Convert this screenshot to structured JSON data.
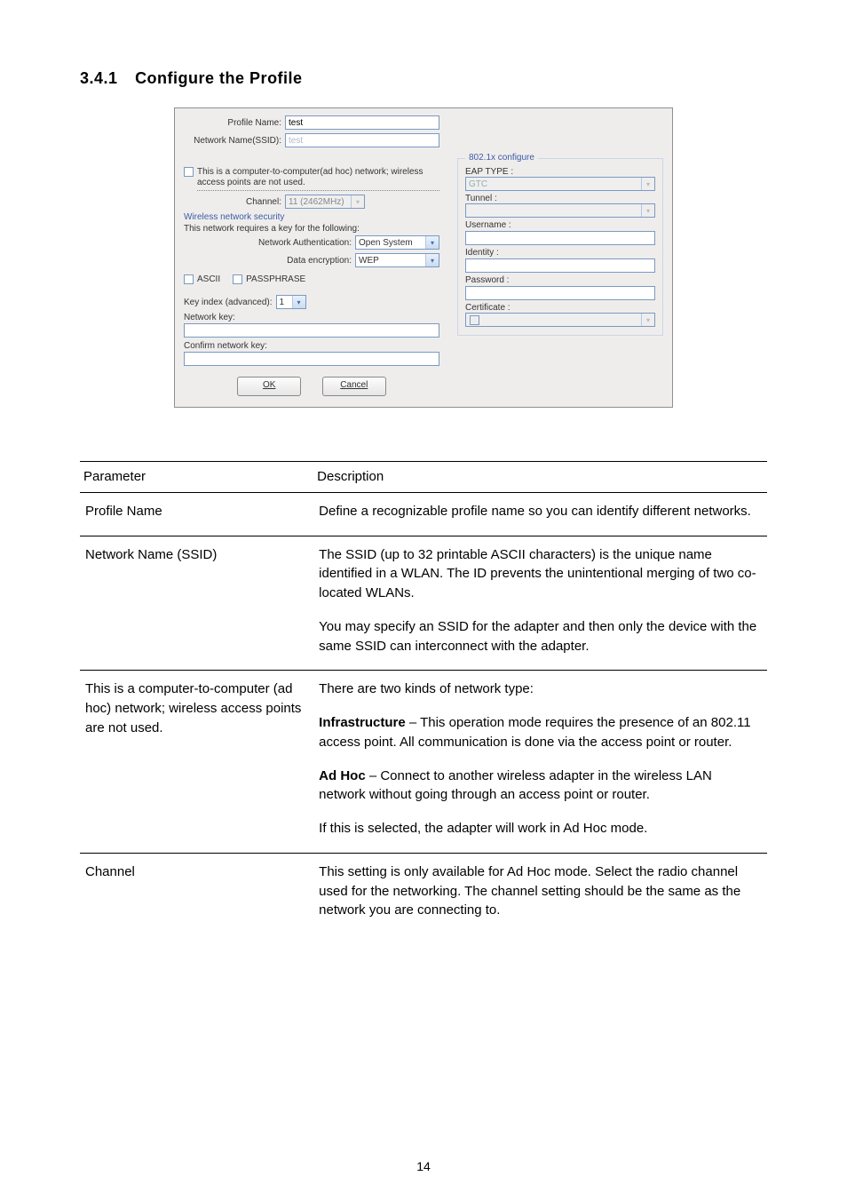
{
  "section": {
    "number": "3.4.1",
    "title": "Configure the Profile"
  },
  "dialog": {
    "profile_name_label": "Profile Name:",
    "profile_name_value": "test",
    "ssid_label": "Network Name(SSID):",
    "ssid_value": "test",
    "adhoc_label": "This is a computer-to-computer(ad hoc) network; wireless access points are not used.",
    "channel_label": "Channel:",
    "channel_value": "11 (2462MHz)",
    "security_heading": "Wireless network security",
    "security_subtext": "This network requires a key for the following:",
    "net_auth_label": "Network Authentication:",
    "net_auth_value": "Open System",
    "data_enc_label": "Data encryption:",
    "data_enc_value": "WEP",
    "ascii_label": "ASCII",
    "passphrase_label": "PASSPHRASE",
    "key_index_label": "Key index (advanced):",
    "key_index_value": "1",
    "network_key_label": "Network key:",
    "confirm_key_label": "Confirm network key:",
    "ok_label": "OK",
    "cancel_label": "Cancel",
    "group_legend": "802.1x configure",
    "eap_type_label": "EAP TYPE :",
    "eap_type_value": "GTC",
    "tunnel_label": "Tunnel :",
    "username_label": "Username :",
    "identity_label": "Identity :",
    "password_label": "Password :",
    "certificate_label": "Certificate :"
  },
  "table": {
    "headers": {
      "param": "Parameter",
      "desc": "Description"
    },
    "rows": [
      {
        "param": "Profile Name",
        "desc": [
          "Define a recognizable profile name so you can identify different networks."
        ]
      },
      {
        "param": "Network Name (SSID)",
        "desc": [
          "The SSID (up to 32 printable ASCII characters) is the unique name identified in a WLAN. The ID prevents the unintentional merging of two co-located WLANs.",
          "You may specify an SSID for the adapter and then only the device with the same SSID can interconnect with the adapter."
        ]
      },
      {
        "param": "This is a computer-to-computer (ad hoc) network; wireless access points are not used.",
        "desc_html": [
          "There are two kinds of network type:",
          "<b>Infrastructure</b> – This operation mode requires the presence of an 802.11 access point. All communication is done via the access point or router.",
          "<b>Ad Hoc</b> – Connect to another wireless adapter in the wireless LAN network without going through an access point or router.",
          "If this is selected, the adapter will work in Ad Hoc mode."
        ]
      },
      {
        "param": "Channel",
        "desc": [
          "This setting is only available for Ad Hoc mode. Select the radio channel used for the networking. The channel setting should be the same as the network you are connecting to."
        ]
      }
    ]
  },
  "page_number": "14"
}
